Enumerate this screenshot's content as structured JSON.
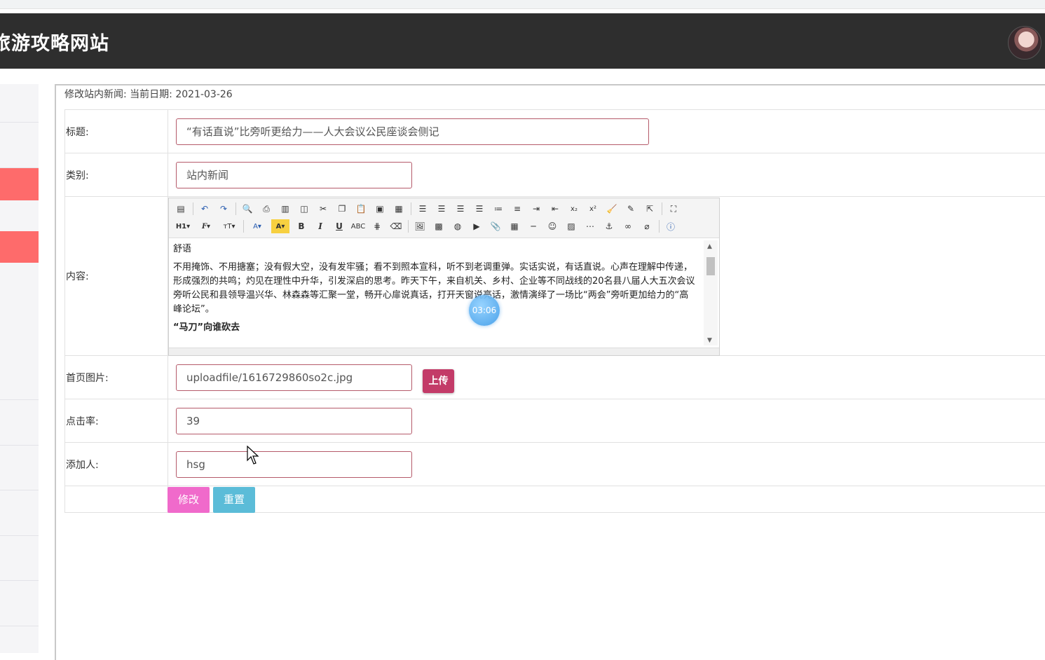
{
  "header": {
    "site_title": "旅游攻略网站"
  },
  "caption": {
    "label": "修改站内新闻:",
    "date_label": "当前日期:",
    "date_value": "2021-03-26"
  },
  "form": {
    "title": {
      "label": "标题:",
      "value": "“有话直说”比旁听更给力——人大会议公民座谈会侧记"
    },
    "category": {
      "label": "类别:",
      "value": "站内新闻"
    },
    "content": {
      "label": "内容:",
      "paragraphs": [
        "舒语",
        "不用掩饰、不用搪塞；没有假大空，没有发牢骚；看不到照本宣科，听不到老调重弹。实话实说，有话直说。心声在理解中传递，形成强烈的共鸣；灼见在理性中升华，引发深启的思考。昨天下午，来自机关、乡村、企业等不同战线的20名县八届人大五次会议旁听公民和县领导温兴华、林森森等汇聚一堂，畅开心扉说真话，打开天窗说亮话，激情演绎了一场比“两会”旁听更加给力的“高峰论坛”。",
        "“马刀”向谁砍去"
      ]
    },
    "image": {
      "label": "首页图片:",
      "value": "uploadfile/1616729860so2c.jpg",
      "upload_button": "上传"
    },
    "clicks": {
      "label": "点击率:",
      "value": "39"
    },
    "author": {
      "label": "添加人:",
      "value": "hsg"
    },
    "buttons": {
      "submit": "修改",
      "reset": "重置"
    }
  },
  "video_timer": "03:06",
  "colors": {
    "header_bg": "#2e2e2e",
    "sidebar_active": "#fe6b6b",
    "upload_button": "#c33b68",
    "submit_button": "#f06acb",
    "reset_button": "#5bbcd8"
  }
}
